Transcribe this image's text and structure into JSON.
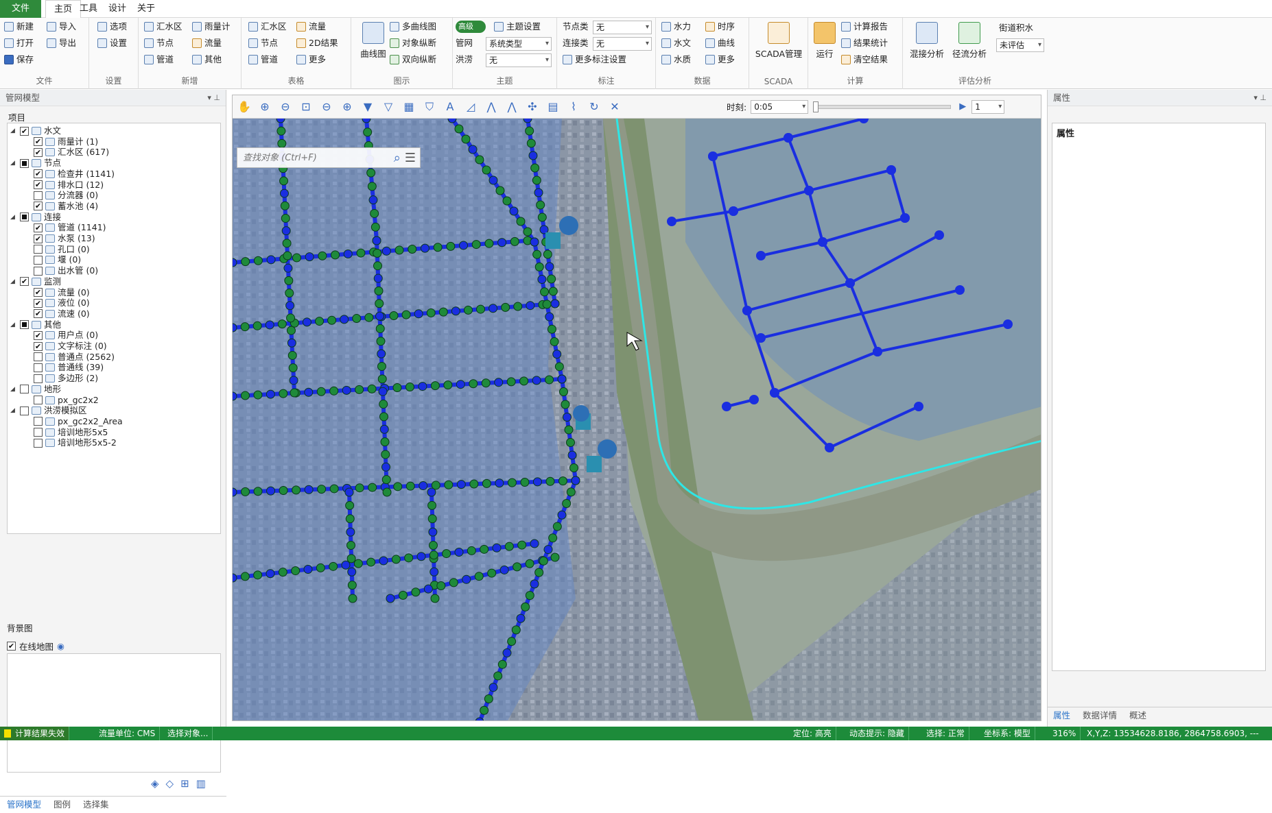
{
  "menubar": {
    "file": "文件",
    "home": "主页",
    "tools": "工具",
    "design": "设计",
    "about": "关于"
  },
  "ribbon": {
    "file": {
      "label": "文件",
      "new": "新建",
      "import": "导入",
      "open": "打开",
      "export": "导出",
      "save": "保存"
    },
    "settings": {
      "label": "设置",
      "options": "选项",
      "settings": "设置"
    },
    "add": {
      "label": "新增",
      "catchment": "汇水区",
      "raingauge": "雨量计",
      "node": "节点",
      "flow": "流量",
      "pipe": "管道",
      "other": "其他"
    },
    "table": {
      "label": "表格",
      "catchment": "汇水区",
      "flow": "流量",
      "node": "节点",
      "result2d": "2D结果",
      "pipe": "管道",
      "more": "更多"
    },
    "chart": {
      "label": "图示",
      "curve": "曲线图",
      "multicurve": "多曲线图",
      "objprofile": "对象纵断",
      "twoway": "双向纵断"
    },
    "theme": {
      "label": "主题",
      "advanced": "高级",
      "themeset": "主题设置",
      "network": "管网",
      "nettype": "系统类型",
      "flood": "洪涝",
      "floodval": "无"
    },
    "annot": {
      "label": "标注",
      "nodetype": "节点类",
      "nodeval": "无",
      "linktype": "连接类",
      "linkval": "无",
      "more": "更多标注设置"
    },
    "data": {
      "label": "数据",
      "hydraulic": "水力",
      "timeseq": "时序",
      "hydro": "水文",
      "curve": "曲线",
      "quality": "水质",
      "more": "更多"
    },
    "scada": {
      "label": "SCADA",
      "manage": "SCADA管理"
    },
    "calc": {
      "label": "计算",
      "run": "运行",
      "report": "计算报告",
      "stats": "结果统计",
      "clear": "清空结果"
    },
    "eval": {
      "label": "评估分析",
      "mixed": "混接分析",
      "runoff": "径流分析",
      "street": "街道积水",
      "streetval": "未评估"
    }
  },
  "left": {
    "title": "管网模型",
    "project": "项目",
    "items": [
      {
        "t": "水文",
        "l": 0
      },
      {
        "t": "雨量计 (1)",
        "l": 1
      },
      {
        "t": "汇水区 (617)",
        "l": 1
      },
      {
        "t": "节点",
        "l": 0
      },
      {
        "t": "检查井 (1141)",
        "l": 1
      },
      {
        "t": "排水口 (12)",
        "l": 1
      },
      {
        "t": "分流器 (0)",
        "l": 1
      },
      {
        "t": "蓄水池 (4)",
        "l": 1
      },
      {
        "t": "连接",
        "l": 0
      },
      {
        "t": "管道 (1141)",
        "l": 1
      },
      {
        "t": "水泵 (13)",
        "l": 1
      },
      {
        "t": "孔口 (0)",
        "l": 1
      },
      {
        "t": "堰 (0)",
        "l": 1
      },
      {
        "t": "出水管 (0)",
        "l": 1
      },
      {
        "t": "监测",
        "l": 0
      },
      {
        "t": "流量 (0)",
        "l": 1
      },
      {
        "t": "液位 (0)",
        "l": 1
      },
      {
        "t": "流速 (0)",
        "l": 1
      },
      {
        "t": "其他",
        "l": 0
      },
      {
        "t": "用户点 (0)",
        "l": 1
      },
      {
        "t": "文字标注 (0)",
        "l": 1
      },
      {
        "t": "普通点 (2562)",
        "l": 1
      },
      {
        "t": "普通线 (39)",
        "l": 1
      },
      {
        "t": "多边形 (2)",
        "l": 1
      },
      {
        "t": "地形",
        "l": 0
      },
      {
        "t": "px_gc2x2",
        "l": 1
      },
      {
        "t": "洪涝模拟区",
        "l": 0
      },
      {
        "t": "px_gc2x2_Area",
        "l": 1
      },
      {
        "t": "培训地形5x5",
        "l": 1
      },
      {
        "t": "培训地形5x5-2",
        "l": 1
      }
    ],
    "bg_title": "背景图",
    "online_map": "在线地图",
    "tabs": {
      "network": "管网模型",
      "legend": "图例",
      "selset": "选择集"
    }
  },
  "map": {
    "time_label": "时刻:",
    "time_value": "0:05",
    "step": "1",
    "search_placeholder": "查找对象 (Ctrl+F)"
  },
  "right": {
    "title": "属性",
    "head": "属性",
    "tabs": {
      "prop": "属性",
      "detail": "数据详情",
      "overview": "概述"
    }
  },
  "status": {
    "calc": "计算结果失效",
    "unit": "流量单位: CMS",
    "select": "选择对象...",
    "locate": "定位: 高亮",
    "hint": "动态提示: 隐藏",
    "selmode": "选择: 正常",
    "coord": "坐标系: 模型",
    "zoom": "316%",
    "xyz": "X,Y,Z: 13534628.8186, 2864758.6903, ---"
  }
}
